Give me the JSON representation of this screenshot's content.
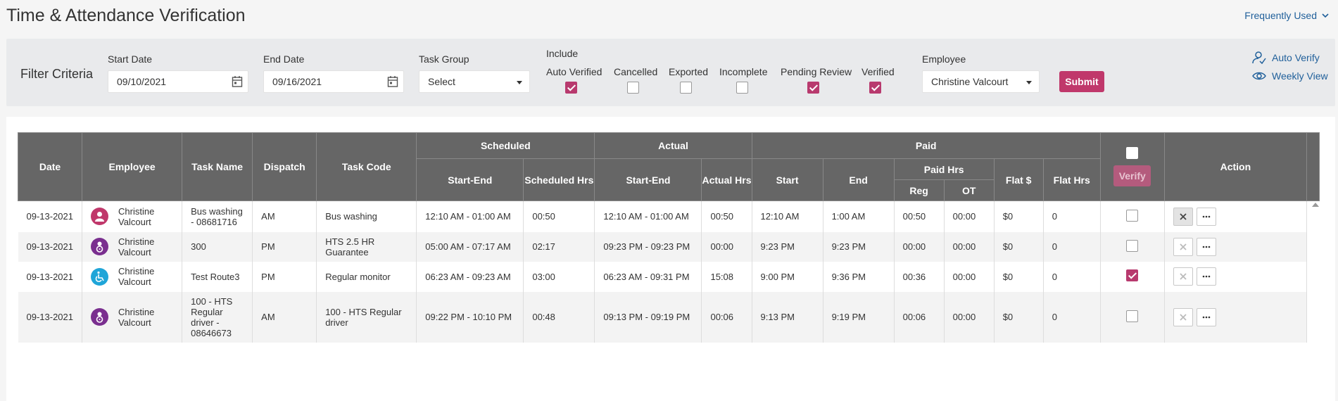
{
  "page": {
    "title": "Time & Attendance Verification",
    "frequently_used": "Frequently Used"
  },
  "filters": {
    "title": "Filter Criteria",
    "start_date_label": "Start Date",
    "start_date_value": "09/10/2021",
    "end_date_label": "End Date",
    "end_date_value": "09/16/2021",
    "task_group_label": "Task Group",
    "task_group_value": "Select",
    "include_label": "Include",
    "include_options": [
      {
        "label": "Auto Verified",
        "checked": true
      },
      {
        "label": "Cancelled",
        "checked": false
      },
      {
        "label": "Exported",
        "checked": false
      },
      {
        "label": "Incomplete",
        "checked": false
      },
      {
        "label": "Pending Review",
        "checked": true
      },
      {
        "label": "Verified",
        "checked": true
      }
    ],
    "employee_label": "Employee",
    "employee_value": "Christine Valcourt",
    "submit_label": "Submit",
    "auto_verify_label": "Auto Verify",
    "weekly_view_label": "Weekly View"
  },
  "table": {
    "headers": {
      "date": "Date",
      "employee": "Employee",
      "task_name": "Task Name",
      "dispatch": "Dispatch",
      "task_code": "Task Code",
      "scheduled": "Scheduled",
      "actual": "Actual",
      "paid": "Paid",
      "sched_start_end": "Start-End",
      "sched_hrs": "Scheduled Hrs",
      "actual_start_end": "Start-End",
      "actual_hrs": "Actual Hrs",
      "paid_start": "Start",
      "paid_end": "End",
      "paid_hrs": "Paid Hrs",
      "reg": "Reg",
      "ot": "OT",
      "flat_dollar": "Flat $",
      "flat_hrs": "Flat Hrs",
      "verify": "Verify",
      "action": "Action"
    },
    "rows": [
      {
        "date": "09-13-2021",
        "employee": "Christine Valcourt",
        "avatar_icon": "person-icon",
        "avatar_color": "#c0386b",
        "task_name": "Bus washing - 08681716",
        "dispatch": "AM",
        "task_code": "Bus washing",
        "sched_start_end": "12:10 AM - 01:00 AM",
        "sched_hrs": "00:50",
        "actual_start_end": "12:10 AM - 01:00 AM",
        "actual_green": false,
        "actual_hrs": "00:50",
        "paid_start": "12:10 AM",
        "paid_end": "1:00 AM",
        "reg": "00:50",
        "ot": "00:00",
        "flat_dollar": "$0",
        "flat_hrs": "0",
        "verified": false,
        "reject_active": true
      },
      {
        "date": "09-13-2021",
        "employee": "Christine Valcourt",
        "avatar_icon": "driver-icon",
        "avatar_color": "#7a2f8f",
        "task_name": "300",
        "dispatch": "PM",
        "task_code": "HTS 2.5 HR Guarantee",
        "sched_start_end": "05:00 AM - 07:17 AM",
        "sched_hrs": "02:17",
        "actual_start_end": "09:23 PM - 09:23 PM",
        "actual_green": true,
        "actual_hrs": "00:00",
        "paid_start": "9:23 PM",
        "paid_end": "9:23 PM",
        "reg": "00:00",
        "ot": "00:00",
        "flat_dollar": "$0",
        "flat_hrs": "0",
        "verified": false,
        "reject_active": false
      },
      {
        "date": "09-13-2021",
        "employee": "Christine Valcourt",
        "avatar_icon": "wheelchair-icon",
        "avatar_color": "#1fa5d8",
        "task_name": "Test Route3",
        "dispatch": "PM",
        "task_code": "Regular monitor",
        "sched_start_end": "06:23 AM - 09:23 AM",
        "sched_hrs": "03:00",
        "actual_start_end": "06:23 AM - 09:31 PM",
        "actual_green": false,
        "actual_hrs": "15:08",
        "paid_start": "9:00 PM",
        "paid_end": "9:36 PM",
        "reg": "00:36",
        "ot": "00:00",
        "flat_dollar": "$0",
        "flat_hrs": "0",
        "verified": true,
        "reject_active": false
      },
      {
        "date": "09-13-2021",
        "employee": "Christine Valcourt",
        "avatar_icon": "driver-icon",
        "avatar_color": "#7a2f8f",
        "task_name": "100 - HTS Regular driver - 08646673",
        "dispatch": "AM",
        "task_code": "100 - HTS Regular driver",
        "sched_start_end": "09:22 PM - 10:10 PM",
        "sched_hrs": "00:48",
        "actual_start_end": "09:13 PM - 09:19 PM",
        "actual_green": true,
        "actual_hrs": "00:06",
        "paid_start": "9:13 PM",
        "paid_end": "9:19 PM",
        "reg": "00:06",
        "ot": "00:00",
        "flat_dollar": "$0",
        "flat_hrs": "0",
        "verified": false,
        "reject_active": false
      }
    ]
  }
}
